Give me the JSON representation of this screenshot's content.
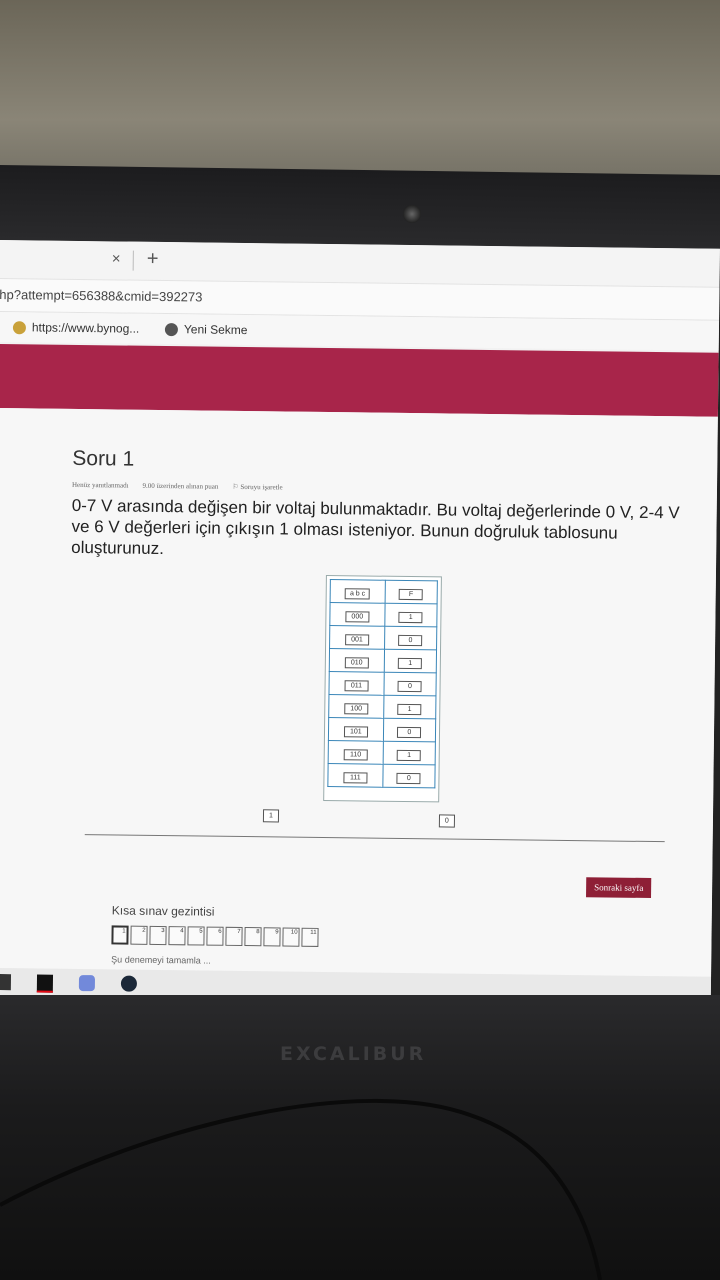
{
  "browser": {
    "tab_close": "×",
    "tab_new": "+",
    "url": "hp?attempt=656388&cmid=392273",
    "bookmarks": [
      {
        "label": "https://www.bynog..."
      },
      {
        "label": "Yeni Sekme"
      }
    ]
  },
  "question": {
    "title": "Soru 1",
    "meta": [
      "Henüz yanıtlanmadı",
      "9.00 üzerinden alınan puan",
      "Soruyu işaretle"
    ],
    "text": "0-7 V arasında değişen bir voltaj bulunmaktadır. Bu voltaj değerlerinde 0 V, 2-4 V ve 6 V değerleri için çıkışın 1 olması isteniyor. Bunun doğruluk tablosunu oluşturunuz."
  },
  "truth_table": {
    "header": {
      "abc": "a b c",
      "f": "F"
    },
    "rows": [
      {
        "abc": "000",
        "f": "1"
      },
      {
        "abc": "001",
        "f": "0"
      },
      {
        "abc": "010",
        "f": "1"
      },
      {
        "abc": "011",
        "f": "0"
      },
      {
        "abc": "100",
        "f": "1"
      },
      {
        "abc": "101",
        "f": "0"
      },
      {
        "abc": "110",
        "f": "1"
      },
      {
        "abc": "111",
        "f": "0"
      }
    ],
    "loose_items": [
      "1",
      "0"
    ]
  },
  "navigation": {
    "next_label": "Sonraki sayfa",
    "quiz_nav_title": "Kısa sınav gezintisi",
    "pages": [
      "1",
      "2",
      "3",
      "4",
      "5",
      "6",
      "7",
      "8",
      "9",
      "10",
      "11"
    ],
    "finish_label": "Şu denemeyi tamamla ..."
  },
  "device": {
    "brand": "EXCALIBUR"
  },
  "colors": {
    "header": "#a8254a",
    "next_button": "#8e1f36",
    "table_border": "#3a86b8"
  }
}
